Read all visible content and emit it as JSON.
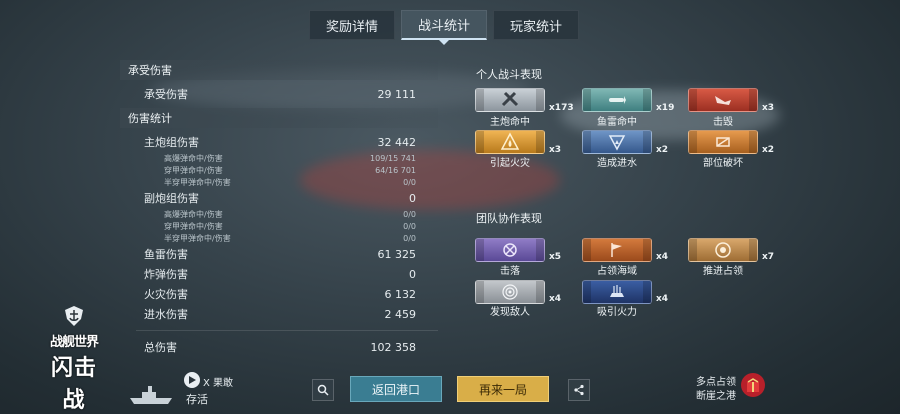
{
  "tabs": [
    {
      "label": "奖励详情"
    },
    {
      "label": "战斗统计"
    },
    {
      "label": "玩家统计"
    }
  ],
  "stats": {
    "received_header": "承受伤害",
    "received": {
      "label": "承受伤害",
      "value": "29 111"
    },
    "damage_header": "伤害统计",
    "main_battery": {
      "label": "主炮组伤害",
      "value": "32 442"
    },
    "main_sub": [
      {
        "label": "高爆弹命中/伤害",
        "value": "109/15 741"
      },
      {
        "label": "穿甲弹命中/伤害",
        "value": "64/16 701"
      },
      {
        "label": "半穿甲弹命中/伤害",
        "value": "0/0"
      }
    ],
    "secondary": {
      "label": "副炮组伤害",
      "value": "0"
    },
    "secondary_sub": [
      {
        "label": "高爆弹命中/伤害",
        "value": "0/0"
      },
      {
        "label": "穿甲弹命中/伤害",
        "value": "0/0"
      },
      {
        "label": "半穿甲弹命中/伤害",
        "value": "0/0"
      }
    ],
    "others": [
      {
        "label": "鱼雷伤害",
        "value": "61 325"
      },
      {
        "label": "炸弹伤害",
        "value": "0"
      },
      {
        "label": "火灾伤害",
        "value": "6 132"
      },
      {
        "label": "进水伤害",
        "value": "2 459"
      }
    ],
    "total": {
      "label": "总伤害",
      "value": "102 358"
    }
  },
  "personal": {
    "title": "个人战斗表现",
    "medals": [
      {
        "label": "主炮命中",
        "count": "x173",
        "color": "silver",
        "icon": "crossed-guns-icon"
      },
      {
        "label": "鱼雷命中",
        "count": "x19",
        "color": "teal",
        "icon": "torpedo-icon"
      },
      {
        "label": "击毁",
        "count": "x3",
        "color": "red",
        "icon": "sinking-ship-icon"
      },
      {
        "label": "引起火灾",
        "count": "x3",
        "color": "gold",
        "icon": "fire-icon"
      },
      {
        "label": "造成进水",
        "count": "x2",
        "color": "blue",
        "icon": "flooding-icon"
      },
      {
        "label": "部位破坏",
        "count": "x2",
        "color": "orange",
        "icon": "module-break-icon"
      }
    ]
  },
  "team": {
    "title": "团队协作表现",
    "medals": [
      {
        "label": "击落",
        "count": "x5",
        "color": "purple",
        "icon": "plane-shot-icon"
      },
      {
        "label": "占领海域",
        "count": "x4",
        "color": "rust",
        "icon": "flag-icon"
      },
      {
        "label": "推进占领",
        "count": "x7",
        "color": "bronze",
        "icon": "capture-icon"
      },
      {
        "label": "发现敌人",
        "count": "x4",
        "color": "grey",
        "icon": "spotting-icon"
      },
      {
        "label": "吸引火力",
        "count": "x4",
        "color": "navy",
        "icon": "tank-fire-icon"
      }
    ]
  },
  "bottom": {
    "logo_line1": "战舰世界",
    "logo_line2": "闪击战",
    "outcome_label": "X 果敢",
    "survival": "存活",
    "back_button": "返回港口",
    "again_button": "再来一局",
    "map_line1": "多点占领",
    "map_line2": "断崖之港"
  }
}
